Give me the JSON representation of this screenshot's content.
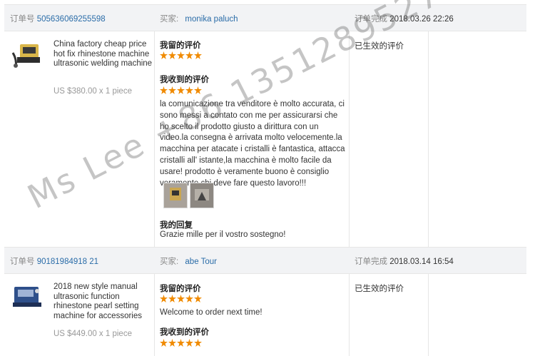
{
  "orders": [
    {
      "order_label": "订单号",
      "order_no": "505636069255598",
      "buyer_label": "买家:",
      "buyer": "monika paluch",
      "completed_label": "订单完成",
      "completed_time": "2018.03.26 22:26",
      "product_title": "China factory cheap price hot fix rhinestone machine ultrasonic welding machine",
      "price": "US $380.00 x 1 piece",
      "my_review_label": "我留的评价",
      "received_label": "我收到的评价",
      "received_text": "la comunicazione tra venditore è molto accurata, ci sono messi a contato con me per assicurarsi che ho scelto il prodotto giusto a dirittura con un video.la consegna è arrivata molto velocemente.la macchina per atacate i cristalli è fantastica, attacca cristalli all' istante,la macchina è molto facile da usare! prodotto è veramente buono è consiglio veramente chi deve fare questo lavoro!!!",
      "reply_label": "我的回复",
      "reply_text": "Grazie mille per il vostro sostegno!",
      "status": "已生效的评价"
    },
    {
      "order_label": "订单号",
      "order_no": "90181984918 21",
      "buyer_label": "买家:",
      "buyer": "abe Tour",
      "completed_label": "订单完成",
      "completed_time": "2018.03.14 16:54",
      "product_title": "2018 new style manual ultrasonic function rhinestone pearl setting machine for accessories",
      "price": "US $449.00 x 1 piece",
      "my_review_label": "我留的评价",
      "my_review_text": "Welcome to order next time!",
      "received_label": "我收到的评价",
      "status": "已生效的评价"
    }
  ],
  "watermark": "Ms Lee +86 13512895278",
  "star_color": "#f08a00"
}
